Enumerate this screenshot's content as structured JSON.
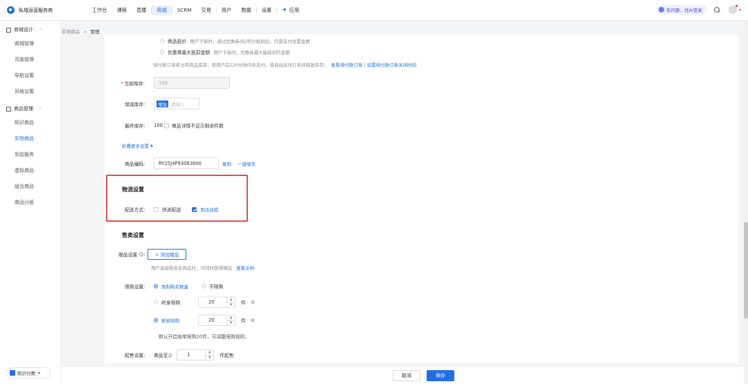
{
  "app": {
    "name": "私域运营服务商"
  },
  "nav": {
    "items": [
      "工作台",
      "课程",
      "直播",
      "商城",
      "SCRM",
      "交易",
      "用户",
      "数据",
      "设置"
    ],
    "active_index": 3,
    "app_label": "应用",
    "ai_label": "有问题，找AI管家"
  },
  "sidebar": {
    "groups": [
      {
        "title": "商城设计",
        "items": [
          "商城管理",
          "页面管理",
          "导航设置",
          "风格设置"
        ]
      },
      {
        "title": "商品管理",
        "items": [
          "知识商品",
          "实物商品",
          "到店服务",
          "虚拟商品",
          "组合商品",
          "商品分组"
        ]
      }
    ],
    "active_item": "实物商品",
    "bottom_label": "知识付费"
  },
  "breadcrumb": {
    "parent": "实物商品",
    "sep": ">",
    "current": "管理"
  },
  "deduct": {
    "option1_title": "商品抵价",
    "option1_desc": "用户下单时，通过优惠券/码/积分抵扣后，仍需支付设置金额",
    "option2_title": "优惠券最大抵扣金额",
    "option2_desc": "用户下单时，优惠券最大能抵扣的金额",
    "note": "待付款订单将占用商品库存，若用户在120分钟内未支付，将自动关闭订单并释放库存。",
    "link1": "查看待付款订单",
    "link_sep": "|",
    "link2": "设置待付款订单关闭时间"
  },
  "stock": {
    "current_label": "当前库存:",
    "current_value": "100",
    "change_label": "增减库存:",
    "change_unit": "增加",
    "change_placeholder": "请输入",
    "final_label": "最终库存:",
    "final_value": "100",
    "hide_label": "商品详情不显示剩余件数"
  },
  "fold": {
    "label": "折叠更多设置"
  },
  "code": {
    "label": "商品编码:",
    "value": "RY25J4P93063600",
    "copy": "复制",
    "fill": "一键填充"
  },
  "logistics": {
    "title": "物流设置",
    "method_label": "配送方式:",
    "option_express": "快递配送",
    "option_pickup": "到店自提",
    "express_checked": false,
    "pickup_checked": true
  },
  "sales": {
    "title": "售卖设置",
    "gift_label": "赠品设置",
    "gift_button": "+ 添加赠品",
    "gift_note": "用户直接购买此商品时，可同时获得赠品",
    "gift_link": "查看示例",
    "limit_label": "限购设置:",
    "limit_on": "限制购买数量",
    "limit_off": "不限购",
    "lifetime_label": "终身限购",
    "lifetime_value": "20",
    "per_order_label": "按单限购",
    "per_order_value": "20",
    "unit": "件",
    "limit_note": "默认开启按单限购20件，可调整限购规则。",
    "min_label": "起售设置:",
    "min_prefix": "商品至少",
    "min_value": "1",
    "min_suffix": "件起售"
  },
  "footer": {
    "cancel": "取消",
    "save": "保存"
  }
}
